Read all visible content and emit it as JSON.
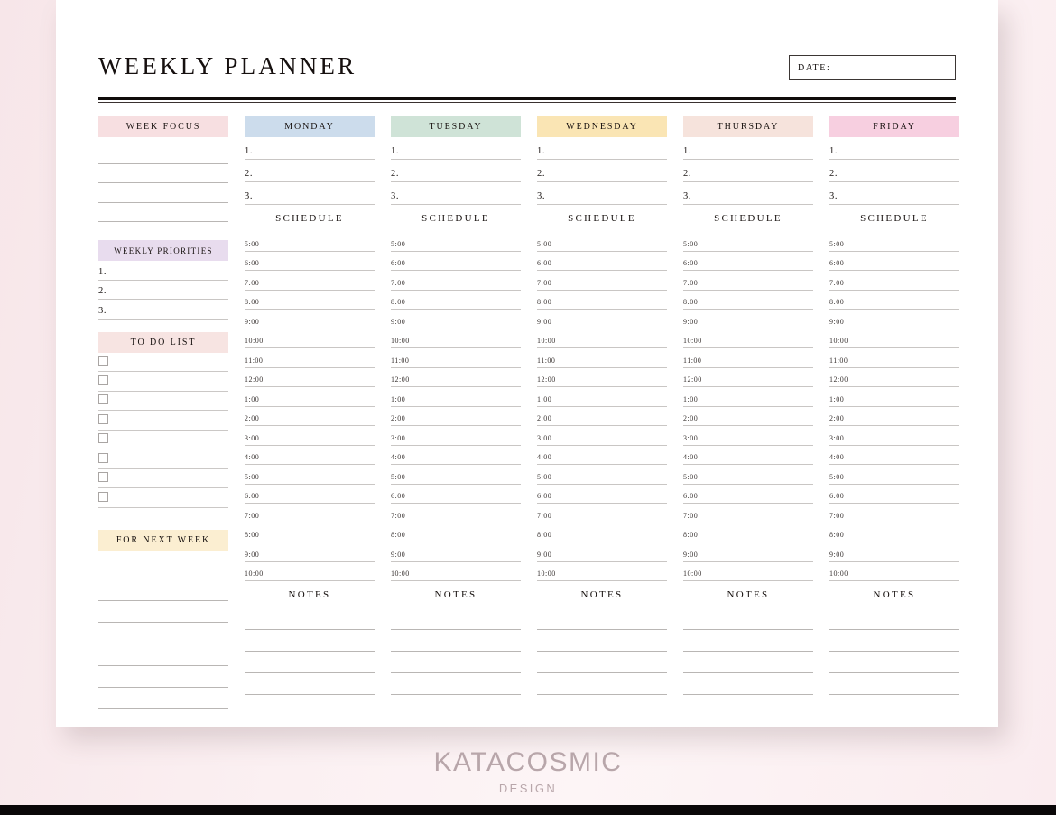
{
  "page": {
    "title": "WEEKLY PLANNER",
    "date_label": "DATE:",
    "background_color": "#fbeff1",
    "sheet_color": "#ffffff"
  },
  "columns": [
    {
      "key": "week_focus",
      "header": "WEEK FOCUS",
      "header_color": "#f7dfe1",
      "blank_lines": 4
    },
    {
      "key": "monday",
      "header": "MONDAY",
      "header_color": "#ccdcec",
      "tasks": [
        "1.",
        "2.",
        "3."
      ],
      "schedule_title": "SCHEDULE",
      "notes_title": "NOTES"
    },
    {
      "key": "tuesday",
      "header": "TUESDAY",
      "header_color": "#cfe3d7",
      "tasks": [
        "1.",
        "2.",
        "3."
      ],
      "schedule_title": "SCHEDULE",
      "notes_title": "NOTES"
    },
    {
      "key": "wednesday",
      "header": "WEDNESDAY",
      "header_color": "#fae5b4",
      "tasks": [
        "1.",
        "2.",
        "3."
      ],
      "schedule_title": "SCHEDULE",
      "notes_title": "NOTES"
    },
    {
      "key": "thursday",
      "header": "THURSDAY",
      "header_color": "#f6e3dc",
      "tasks": [
        "1.",
        "2.",
        "3."
      ],
      "schedule_title": "SCHEDULE",
      "notes_title": "NOTES"
    },
    {
      "key": "friday",
      "header": "FRIDAY",
      "header_color": "#f7cfe0",
      "tasks": [
        "1.",
        "2.",
        "3."
      ],
      "schedule_title": "SCHEDULE",
      "notes_title": "NOTES"
    }
  ],
  "schedule_times": [
    "5:00",
    "6:00",
    "7:00",
    "8:00",
    "9:00",
    "10:00",
    "11:00",
    "12:00",
    "1:00",
    "2:00",
    "3:00",
    "4:00",
    "5:00",
    "6:00",
    "7:00",
    "8:00",
    "9:00",
    "10:00"
  ],
  "sidebar": {
    "weekly_priorities": {
      "header": "WEEKLY PRIORITIES",
      "header_color": "#e8dcee",
      "items": [
        "1.",
        "2.",
        "3."
      ]
    },
    "to_do_list": {
      "header": "TO DO LIST",
      "header_color": "#f7e4e2",
      "checkbox_count": 8
    },
    "for_next_week": {
      "header": "FOR NEXT WEEK",
      "header_color": "#fbeed1",
      "blank_lines": 7
    }
  },
  "notes_lines": 4,
  "footer": {
    "brand": "KATACOSMIC",
    "sub": "DESIGN",
    "color": "#b8a6aa"
  }
}
